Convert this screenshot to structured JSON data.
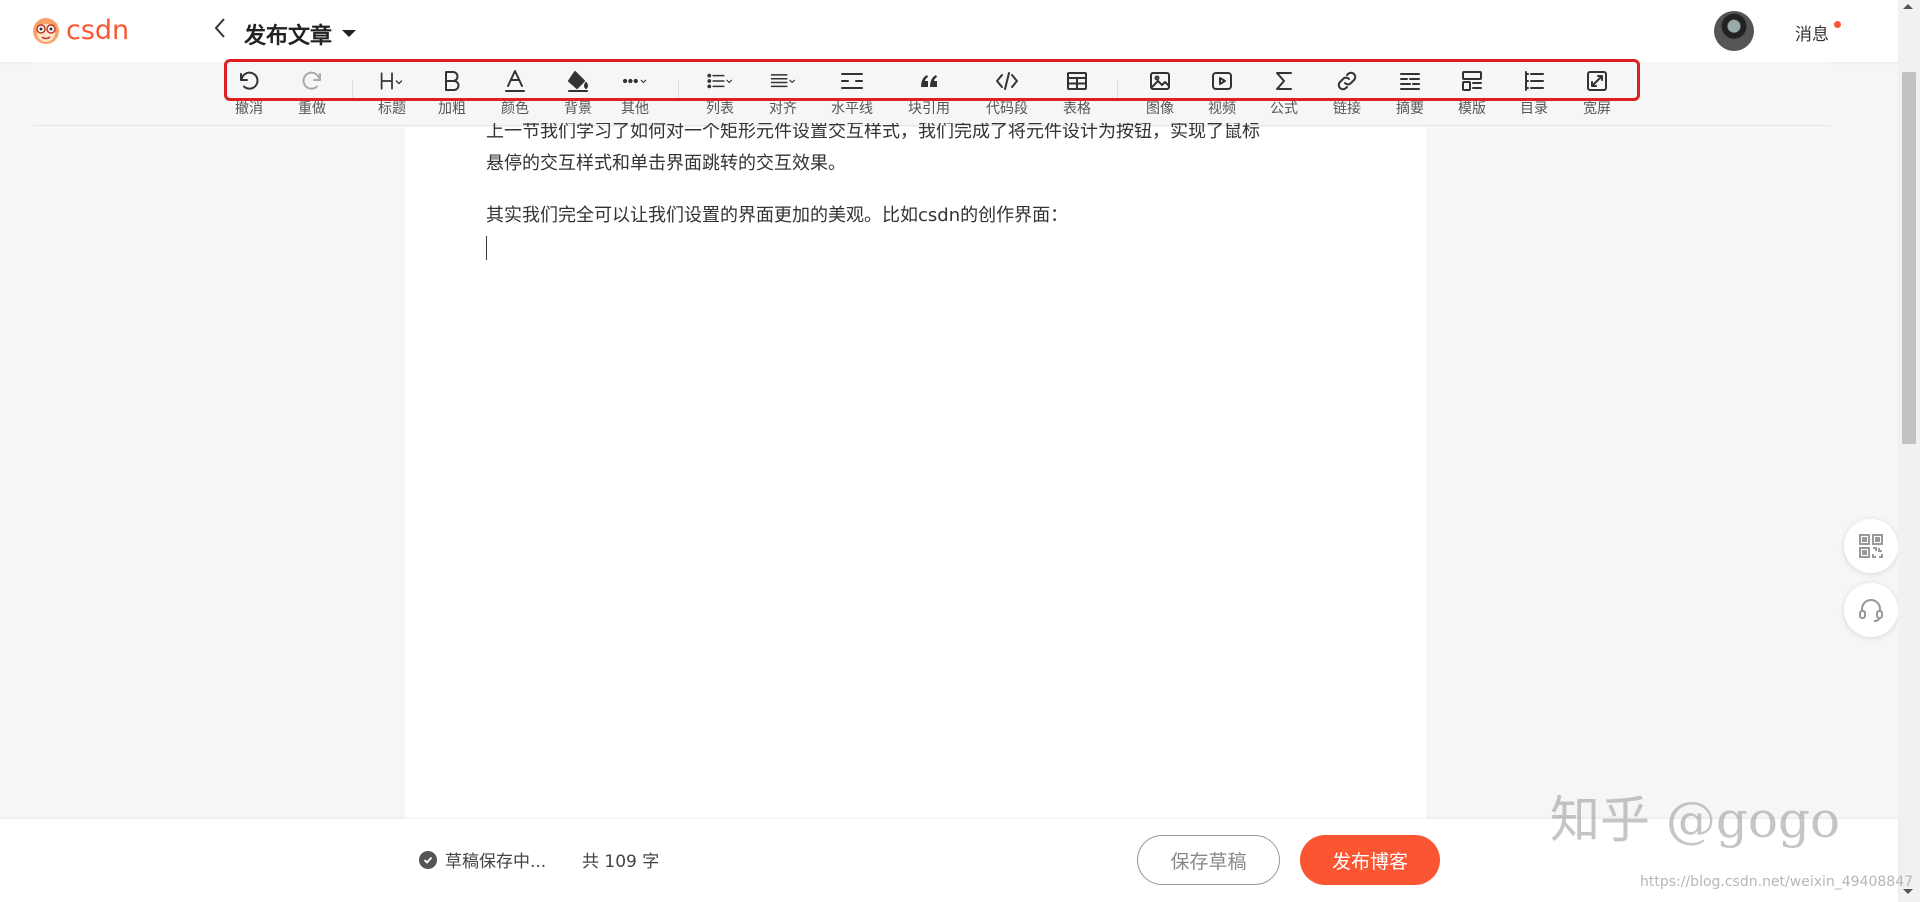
{
  "header": {
    "logo_text": "csdn",
    "title": "发布文章",
    "messages_label": "消息"
  },
  "toolbar": {
    "items": [
      {
        "label": "撤消",
        "icon": "undo-icon"
      },
      {
        "label": "重做",
        "icon": "redo-icon"
      },
      {
        "label": "标题",
        "icon": "heading-icon"
      },
      {
        "label": "加粗",
        "icon": "bold-icon"
      },
      {
        "label": "颜色",
        "icon": "font-color-icon"
      },
      {
        "label": "背景",
        "icon": "paint-bucket-icon"
      },
      {
        "label": "其他",
        "icon": "more-icon"
      },
      {
        "label": "列表",
        "icon": "list-icon"
      },
      {
        "label": "对齐",
        "icon": "align-icon"
      },
      {
        "label": "水平线",
        "icon": "horizontal-rule-icon"
      },
      {
        "label": "块引用",
        "icon": "quote-icon"
      },
      {
        "label": "代码段",
        "icon": "code-icon"
      },
      {
        "label": "表格",
        "icon": "table-icon"
      },
      {
        "label": "图像",
        "icon": "image-icon"
      },
      {
        "label": "视频",
        "icon": "video-icon"
      },
      {
        "label": "公式",
        "icon": "sigma-icon"
      },
      {
        "label": "链接",
        "icon": "link-icon"
      },
      {
        "label": "摘要",
        "icon": "summary-icon"
      },
      {
        "label": "模版",
        "icon": "template-icon"
      },
      {
        "label": "目录",
        "icon": "toc-icon"
      },
      {
        "label": "宽屏",
        "icon": "widescreen-icon"
      }
    ]
  },
  "editor": {
    "paragraphs": [
      "上一节我们学习了如何对一个矩形元件设置交互样式，我们完成了将元件设计为按钮，实现了鼠标",
      "悬停的交互样式和单击界面跳转的交互效果。",
      "其实我们完全可以让我们设置的界面更加的美观。比如csdn的创作界面："
    ]
  },
  "footer": {
    "status": "草稿保存中...",
    "word_count": "共 109 字",
    "save_draft": "保存草稿",
    "publish": "发布博客"
  },
  "side": {
    "qr": "qr-code-icon",
    "support": "headset-icon"
  },
  "watermark": {
    "text": "知乎 @gogo",
    "url": "https://blog.csdn.net/weixin_49408847"
  },
  "colors": {
    "brand": "#fc5531",
    "highlight": "#e02020"
  }
}
